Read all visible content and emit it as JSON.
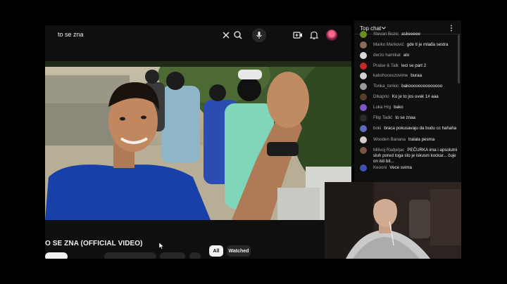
{
  "search": {
    "query": "to se zna"
  },
  "video": {
    "title": "O SE ZNA (OFFICIAL VIDEO)"
  },
  "filters": {
    "all": "All",
    "watched": "Watched"
  },
  "chat": {
    "title": "Top chat",
    "messages": [
      {
        "author": "Stevan Bozic",
        "text": "askeeeee",
        "color": "#6b8e23"
      },
      {
        "author": "Marko Marković",
        "text": "gde ti je mlađa sestra",
        "color": "#8c6d5a"
      },
      {
        "author": "derzo hamikat",
        "text": "alo",
        "color": "#d9d9d9"
      },
      {
        "author": "Praise & Talk",
        "text": "leci se part 2",
        "color": "#c62828"
      },
      {
        "author": "kakohoceszovime",
        "text": "buraa",
        "color": "#cfcfcf"
      },
      {
        "author": "Tonka_tonkic",
        "text": "bakoooooooooooooo",
        "color": "#9a9a9a"
      },
      {
        "author": "Dikaprio",
        "text": "Ko je to jos uvek 1# aaa",
        "color": "#5a3b2a"
      },
      {
        "author": "Luka Hrg",
        "text": "bako",
        "color": "#7e57c2"
      },
      {
        "author": "Filip Tadić",
        "text": "to se znaa",
        "color": "#2a2a2a"
      },
      {
        "author": "boki",
        "text": "braca pokusavaju da budu cc hahaha",
        "color": "#5c6bc0"
      },
      {
        "author": "Wooden Banana",
        "text": "tralala pesma",
        "color": "#d7ccc8"
      },
      {
        "author": "Milivoj Radjeljac",
        "text": "PEČURKA ima i apsolutni sluh pored toga sto je iskusni kockar... čuje on isti bit...",
        "color": "#795548"
      },
      {
        "author": "Keooni",
        "text": "Vece svima",
        "color": "#3f51b5"
      }
    ]
  },
  "colors": {
    "background": "#0f0f0f",
    "chip_active": "#f1f1f1",
    "chip_inactive": "#272727"
  },
  "icons": [
    "clear-icon",
    "search-icon",
    "mic-icon",
    "create-icon",
    "bell-icon",
    "chevron-down-icon",
    "more-vert-icon",
    "cursor-icon"
  ]
}
